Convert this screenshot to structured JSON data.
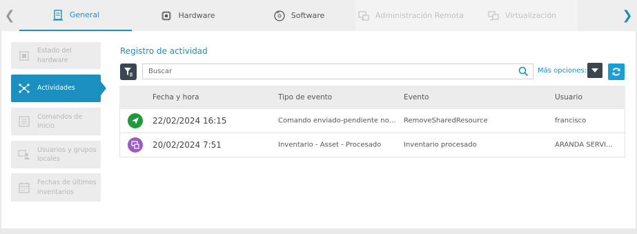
{
  "tabs": [
    {
      "label": "General",
      "icon": "document-icon",
      "state": "active"
    },
    {
      "label": "Hardware",
      "icon": "chip-icon",
      "state": "normal"
    },
    {
      "label": "Software",
      "icon": "disc-icon",
      "state": "normal"
    },
    {
      "label": "Administración Remota",
      "icon": "remote-admin-icon",
      "state": "disabled"
    },
    {
      "label": "Virtualización",
      "icon": "virtualization-icon",
      "state": "disabled"
    }
  ],
  "sidebar": {
    "items": [
      {
        "label": "Estado del hardware",
        "icon": "chip-icon",
        "state": "disabled"
      },
      {
        "label": "Actividades",
        "icon": "network-nodes-icon",
        "state": "active"
      },
      {
        "label": "Comandos de Inicio",
        "icon": "list-icon",
        "state": "disabled"
      },
      {
        "label": "Usuarios y grupos locales",
        "icon": "users-icon",
        "state": "disabled"
      },
      {
        "label": "Fechas de últimos inventarios",
        "icon": "calendar-icon",
        "state": "disabled"
      }
    ]
  },
  "main": {
    "title": "Registro de actividad",
    "search_placeholder": "Buscar",
    "more_options": "Más opciones:",
    "columns": [
      "Fecha y hora",
      "Tipo de evento",
      "Evento",
      "Usuario"
    ],
    "rows": [
      {
        "icon": "send-icon",
        "icon_color": "#1e9a3c",
        "date": "22/02/2024 16:15",
        "type": "Comando enviado-pendiente noti...",
        "event": "RemoveSharedResource",
        "user": "francisco"
      },
      {
        "icon": "inventory-icon",
        "icon_color": "#9a5cc0",
        "date": "20/02/2024 7:51",
        "type": "Inventario - Asset - Procesado",
        "event": "Inventario procesado",
        "user": "ARANDA SERVI..."
      }
    ]
  },
  "colors": {
    "accent": "#1a8fc0",
    "dark_button": "#3c4650",
    "refresh": "#1a9ed4"
  }
}
